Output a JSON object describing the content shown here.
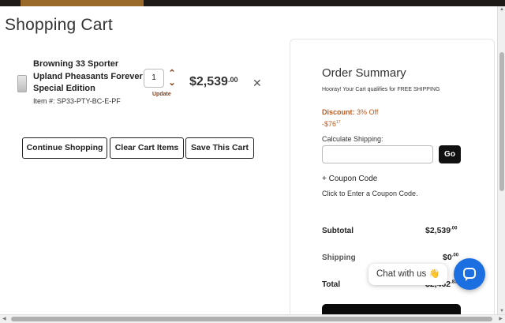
{
  "page": {
    "title": "Shopping Cart"
  },
  "cart": {
    "item": {
      "name": "Browning 33 Sporter Upland Pheasants Forever Special Edition",
      "sku": "Item #: SP33-PTY-BC-E-PF",
      "quantity": "1",
      "update_label": "Update",
      "price_main": "$2,539",
      "price_cents": ".00",
      "remove_icon": "close-icon",
      "qty_up_icon": "chevron-up-icon",
      "qty_down_icon": "chevron-down-icon"
    },
    "buttons": {
      "continue": "Continue Shopping",
      "clear": "Clear Cart Items",
      "save": "Save This Cart"
    }
  },
  "summary": {
    "title": "Order Summary",
    "free_shipping_note": "Hooray! Your Cart qualifies for FREE SHIPPING",
    "discount_label": "Discount:",
    "discount_value": "3% Off",
    "discount_amount": "-$76",
    "discount_amount_cents": "17",
    "calc_shipping_label": "Calculate Shipping:",
    "shipping_input_value": "",
    "go_label": "Go",
    "coupon_toggle": "+ Coupon Code",
    "coupon_hint": "Click to Enter a Coupon Code.",
    "subtotal_label": "Subtotal",
    "subtotal_value": "$2,539",
    "subtotal_cents": ".00",
    "shipping_label": "Shipping",
    "shipping_value": "$0",
    "shipping_cents": ".00",
    "total_label": "Total",
    "total_value": "$2,462",
    "total_cents": ".83"
  },
  "chat": {
    "label": "Chat with us",
    "emoji": "👋",
    "icon": "chat-bubble-icon"
  },
  "colors": {
    "accent_brown": "#9a6a2a",
    "link_rust": "#8a3b12",
    "discount_orange": "#c0581b",
    "chat_blue": "#1b6fe0",
    "topbar": "#1e1a17"
  }
}
